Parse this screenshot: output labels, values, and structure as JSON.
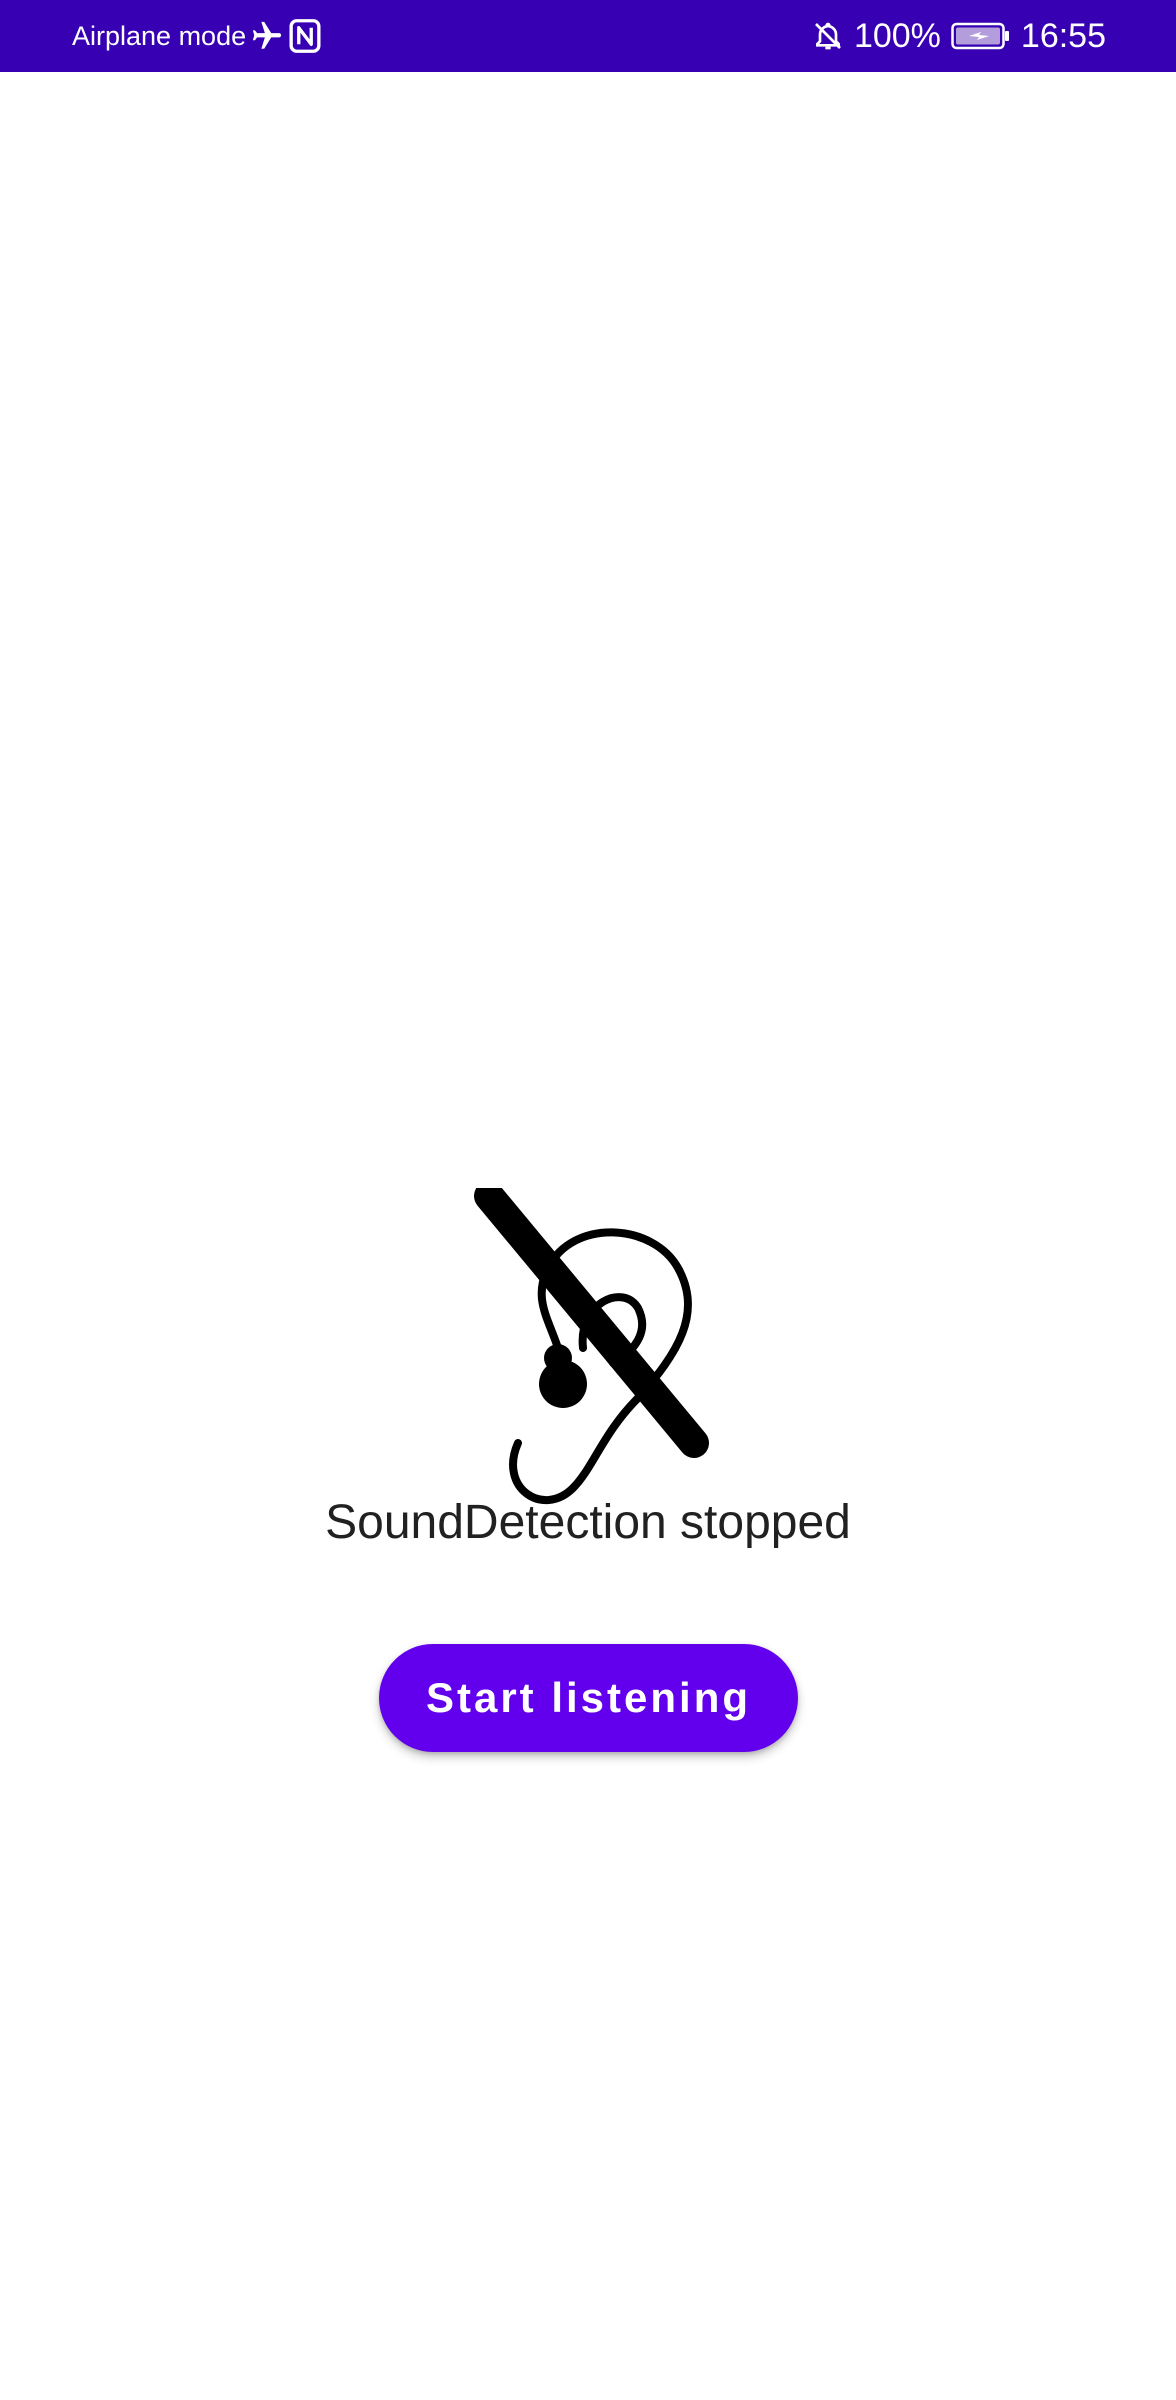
{
  "status_bar": {
    "mode_label": "Airplane mode",
    "battery_percent": "100%",
    "time": "16:55",
    "icons": [
      "airplane-icon",
      "nfc-icon",
      "bell-off-icon",
      "battery-charging-icon"
    ],
    "background_color": "#3700b3"
  },
  "main": {
    "status_icon": "ear-muted-icon",
    "status_text": "SoundDetection stopped",
    "start_button_label": "Start listening",
    "accent_color": "#6200ee"
  }
}
